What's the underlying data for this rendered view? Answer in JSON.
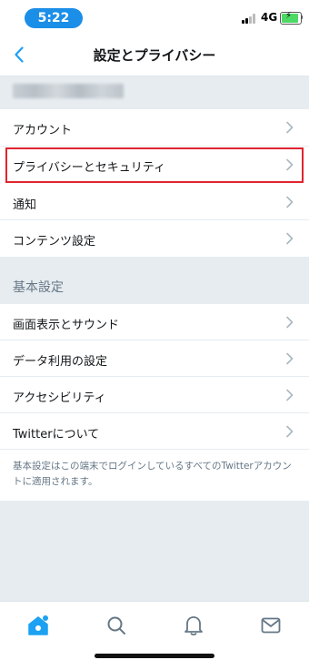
{
  "status_bar": {
    "time": "5:22",
    "network": "4G",
    "battery_level": 0.9,
    "time_pill_color": "#1b8ee8"
  },
  "nav": {
    "title": "設定とプライバシー",
    "back_icon": "chevron-left-icon"
  },
  "account_group": {
    "items": [
      {
        "label": "アカウント"
      },
      {
        "label": "プライバシーとセキュリティ"
      },
      {
        "label": "通知"
      },
      {
        "label": "コンテンツ設定"
      }
    ]
  },
  "basic_group": {
    "header": "基本設定",
    "items": [
      {
        "label": "画面表示とサウンド"
      },
      {
        "label": "データ利用の設定"
      },
      {
        "label": "アクセシビリティ"
      },
      {
        "label": "Twitterについて"
      }
    ],
    "footnote": "基本設定はこの端末でログインしているすべてのTwitterアカウントに適用されます。"
  },
  "tab_bar": {
    "tabs": [
      {
        "icon": "home-icon",
        "active": true
      },
      {
        "icon": "search-icon",
        "active": false
      },
      {
        "icon": "bell-icon",
        "active": false
      },
      {
        "icon": "mail-icon",
        "active": false
      }
    ]
  },
  "colors": {
    "accent": "#1da1f2",
    "highlight_border": "#e0242e",
    "background": "#e6ecf0",
    "secondary_text": "#657786"
  }
}
